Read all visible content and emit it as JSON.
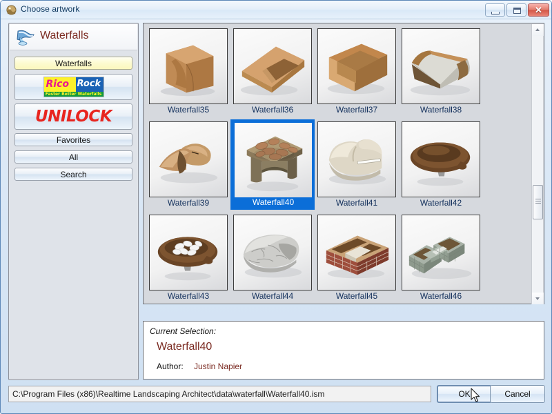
{
  "window": {
    "title": "Choose artwork",
    "title_icon": "artwork-icon",
    "minimize_label": "",
    "maximize_label": "",
    "close_label": "✕"
  },
  "sidebar": {
    "header_title": "Waterfalls",
    "header_icon": "waterfall-icon",
    "buttons": [
      {
        "id": "waterfalls",
        "label": "Waterfalls",
        "type": "text",
        "active": true
      },
      {
        "id": "ricorock",
        "label": "RicoRock",
        "type": "logo",
        "active": false,
        "logo": {
          "word1": "Rico",
          "word2": "Rock",
          "tagline": "Faster Better Waterfalls"
        }
      },
      {
        "id": "unilock",
        "label": "UNILOCK",
        "type": "logo",
        "active": false
      },
      {
        "id": "favorites",
        "label": "Favorites",
        "type": "text",
        "active": false
      },
      {
        "id": "all",
        "label": "All",
        "type": "text",
        "active": false
      },
      {
        "id": "search",
        "label": "Search",
        "type": "text",
        "active": false
      }
    ]
  },
  "grid": {
    "items": [
      {
        "label": "Waterfall35",
        "selected": false,
        "art": "block-curved-chute"
      },
      {
        "label": "Waterfall36",
        "selected": false,
        "art": "flat-angled-slab"
      },
      {
        "label": "Waterfall37",
        "selected": false,
        "art": "open-box"
      },
      {
        "label": "Waterfall38",
        "selected": false,
        "art": "curved-basin-pan"
      },
      {
        "label": "Waterfall39",
        "selected": false,
        "art": "rock-boulder"
      },
      {
        "label": "Waterfall40",
        "selected": true,
        "art": "stacked-stone-table"
      },
      {
        "label": "Waterfall41",
        "selected": false,
        "art": "smooth-stone-slot"
      },
      {
        "label": "Waterfall42",
        "selected": false,
        "art": "brown-round-dish"
      },
      {
        "label": "Waterfall43",
        "selected": false,
        "art": "dish-with-pebbles"
      },
      {
        "label": "Waterfall44",
        "selected": false,
        "art": "granite-bowl-rock"
      },
      {
        "label": "Waterfall45",
        "selected": false,
        "art": "brick-planter-box"
      },
      {
        "label": "Waterfall46",
        "selected": false,
        "art": "stone-corner-planter"
      }
    ]
  },
  "selection": {
    "caption": "Current Selection:",
    "name": "Waterfall40",
    "author_label": "Author:",
    "author_value": "Justin Napier"
  },
  "footer": {
    "path": "C:\\Program Files (x86)\\Realtime Landscaping Architect\\data\\waterfall\\Waterfall40.ism",
    "ok_label": "OK",
    "cancel_label": "Cancel"
  },
  "colors": {
    "selection_blue": "#0b6ed8",
    "accent_maroon": "#7b2b22",
    "label_blue": "#13305c",
    "unilock_red": "#e8251f"
  }
}
